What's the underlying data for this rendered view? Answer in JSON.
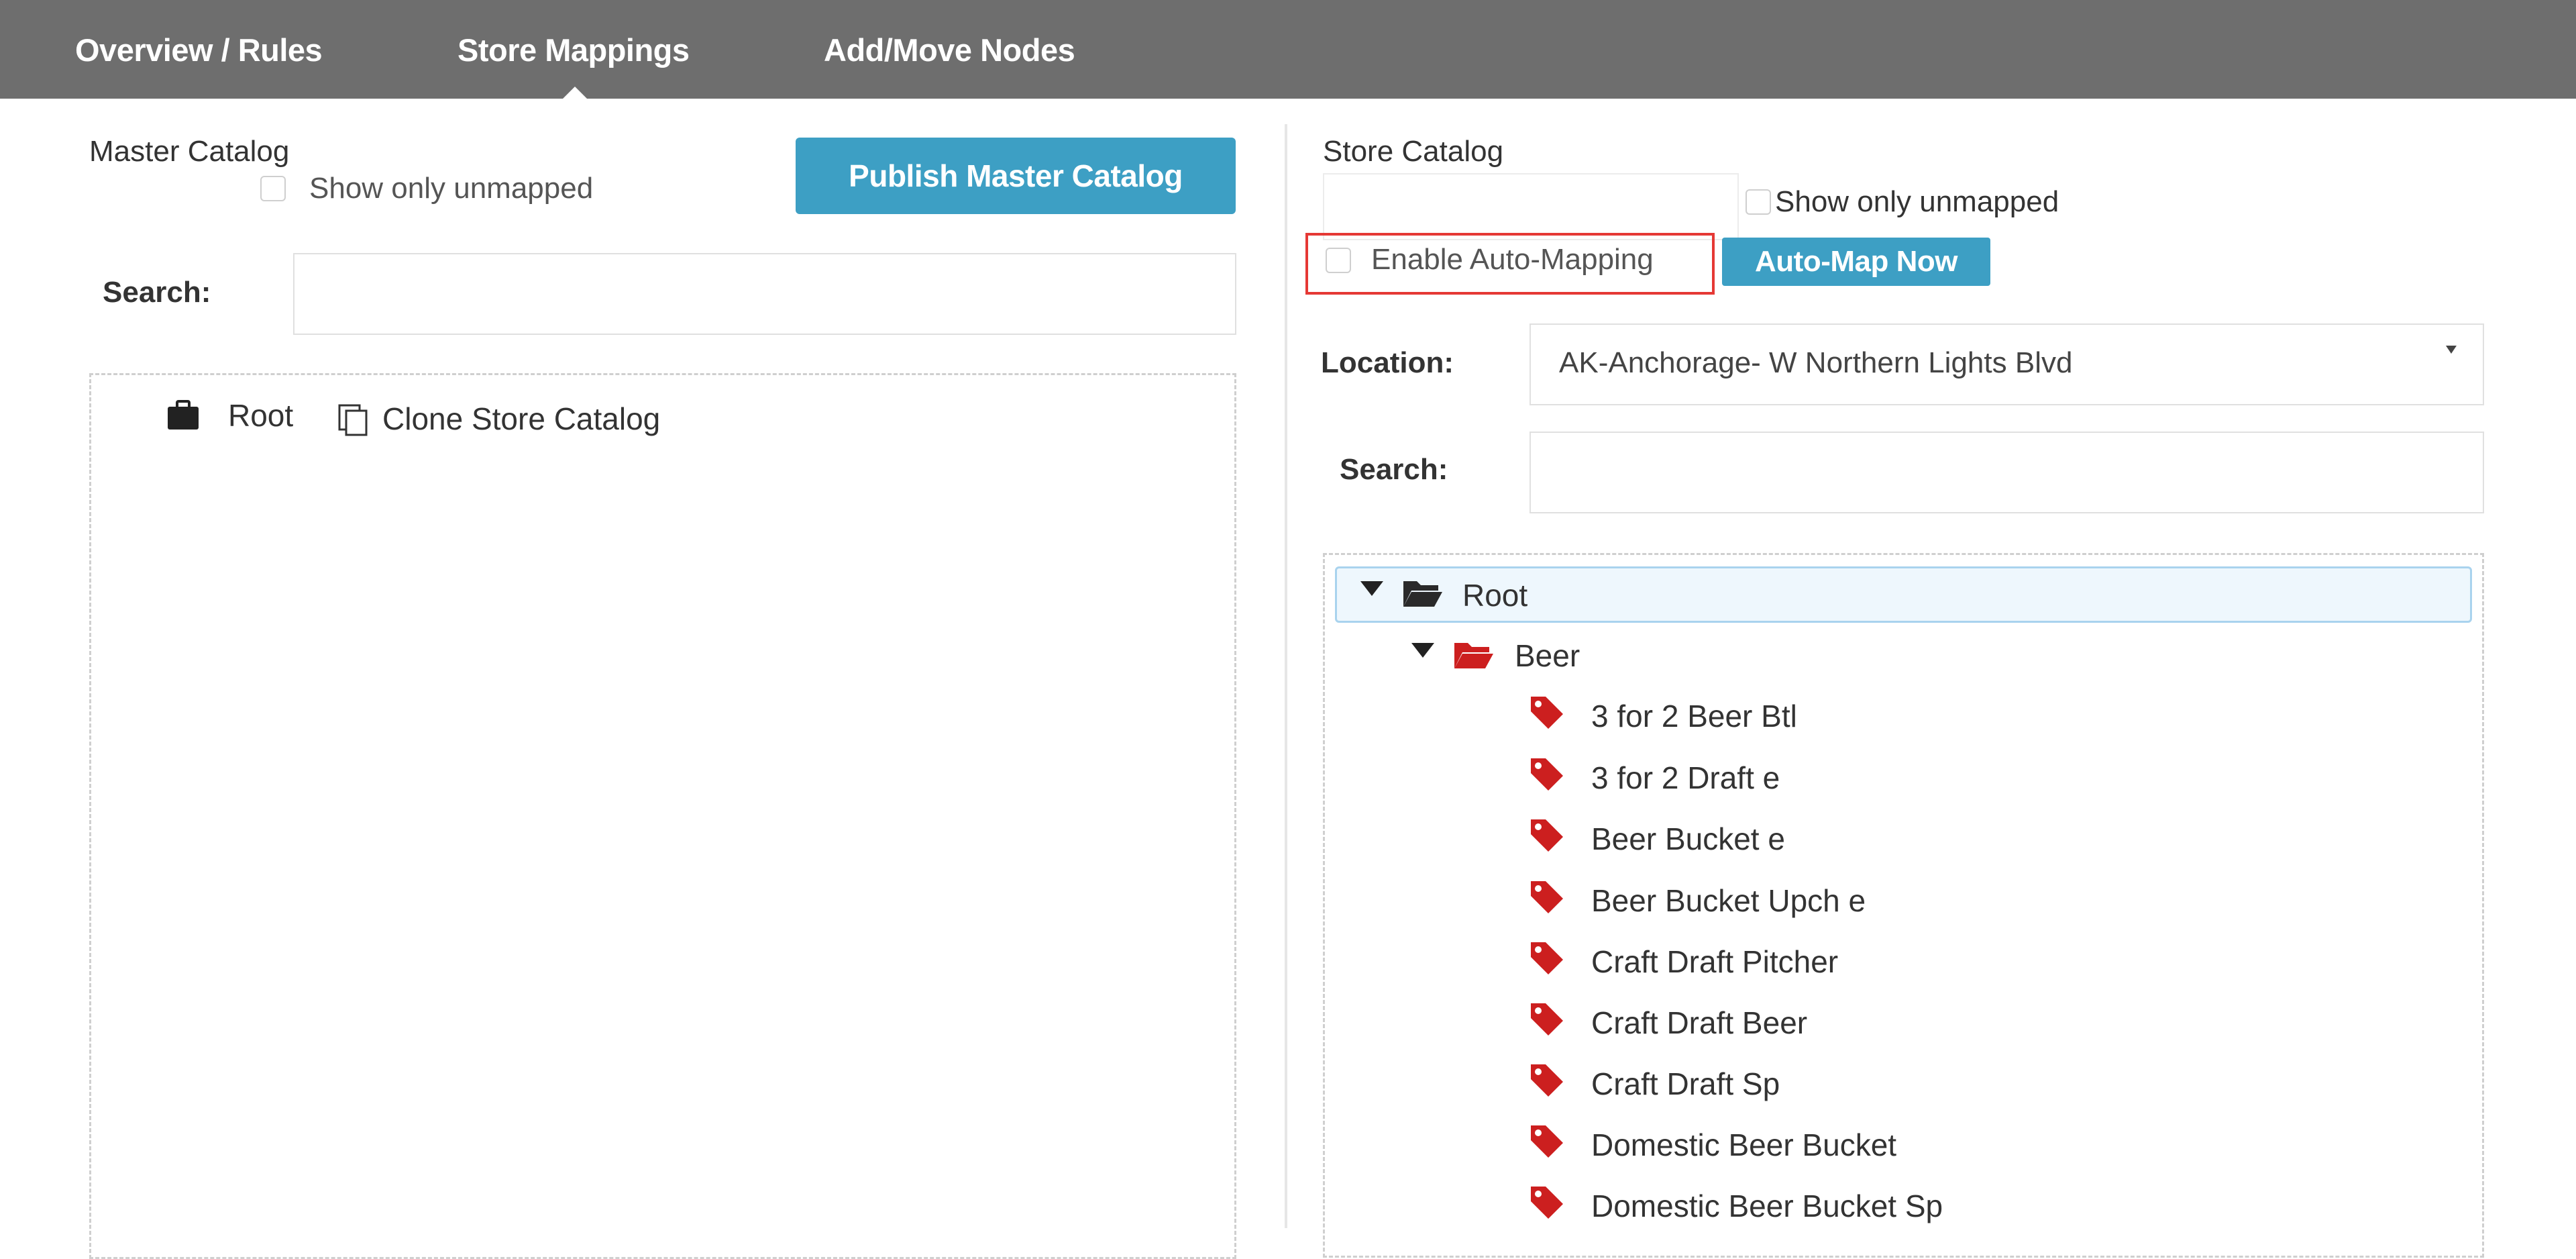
{
  "nav": {
    "tabs": [
      {
        "label": "Overview / Rules"
      },
      {
        "label": "Store Mappings"
      },
      {
        "label": "Add/Move Nodes"
      }
    ],
    "active_tab": "Store Mappings"
  },
  "master": {
    "title": "Master Catalog",
    "show_unmapped_label": "Show only unmapped",
    "publish_button": "Publish Master Catalog",
    "search_label": "Search:",
    "search_value": "",
    "tree": {
      "root_label": "Root",
      "clone_label": "Clone Store Catalog"
    }
  },
  "store": {
    "title": "Store Catalog",
    "show_unmapped_label": "Show only unmapped",
    "auto_mapping_label": "Enable Auto-Mapping",
    "auto_map_button": "Auto-Map Now",
    "location_label": "Location:",
    "location_value": "AK-Anchorage- W Northern Lights Blvd",
    "search_label": "Search:",
    "search_value": "",
    "tree": {
      "root_label": "Root",
      "folder_label": "Beer",
      "items": [
        "3 for 2 Beer Btl",
        "3 for 2 Draft e",
        "Beer Bucket e",
        "Beer Bucket Upch e",
        "Craft Draft Pitcher",
        "Craft Draft Beer",
        "Craft Draft Sp",
        "Domestic Beer Bucket",
        "Domestic Beer Bucket Sp"
      ]
    }
  },
  "colors": {
    "nav_bg": "#6e6e6e",
    "button_bg": "#3d9fc4",
    "tag_red": "#cc1f1f",
    "highlight_border": "#e53935",
    "selected_row_bg": "#eef7fd"
  },
  "icons": [
    "briefcase-icon",
    "copy-icon",
    "caret-down-icon",
    "folder-open-icon",
    "tag-icon",
    "dropdown-arrow-icon"
  ]
}
